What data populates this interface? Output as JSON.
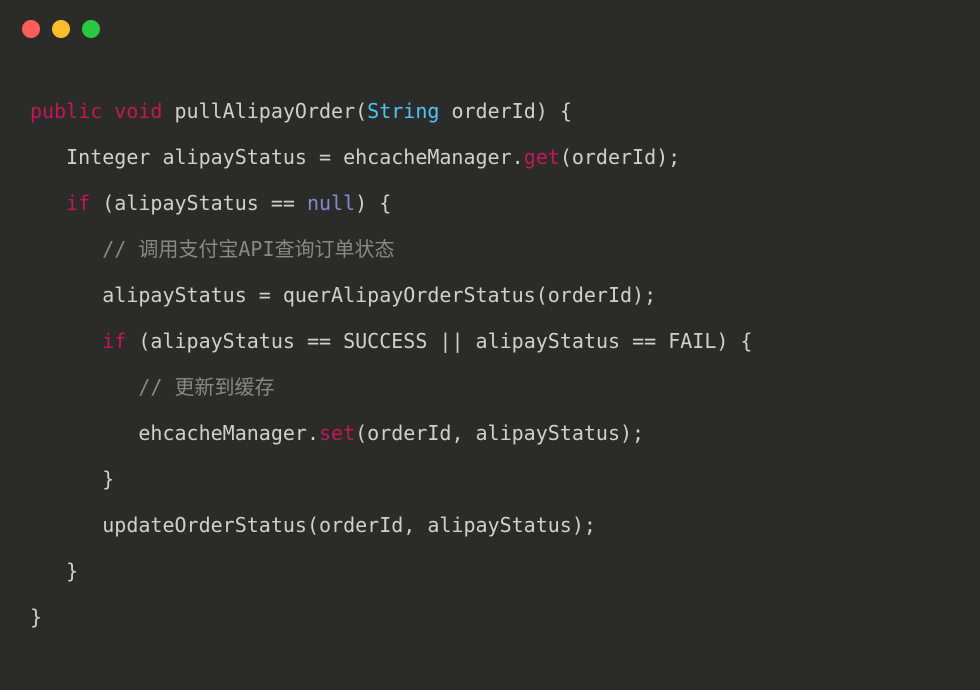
{
  "code": {
    "line1": {
      "public": "public",
      "void": "void",
      "funcName": " pullAlipayOrder(",
      "paramType": "String",
      "paramRest": " orderId) {"
    },
    "line2": "   Integer alipayStatus = ehcacheManager.",
    "line2method": "get",
    "line2rest": "(orderId);",
    "line3a": "   ",
    "line3if": "if",
    "line3b": " (alipayStatus == ",
    "line3null": "null",
    "line3c": ") {",
    "line4": "      // 调用支付宝API查询订单状态",
    "line5": "      alipayStatus = querAlipayOrderStatus(orderId);",
    "line6a": "      ",
    "line6if": "if",
    "line6b": " (alipayStatus == SUCCESS || alipayStatus == FAIL) {",
    "line7": "         // 更新到缓存",
    "line8a": "         ehcacheManager.",
    "line8method": "set",
    "line8b": "(orderId, alipayStatus);",
    "line9": "      }",
    "line10": "      updateOrderStatus(orderId, alipayStatus);",
    "line11": "   }",
    "line12": "}"
  }
}
